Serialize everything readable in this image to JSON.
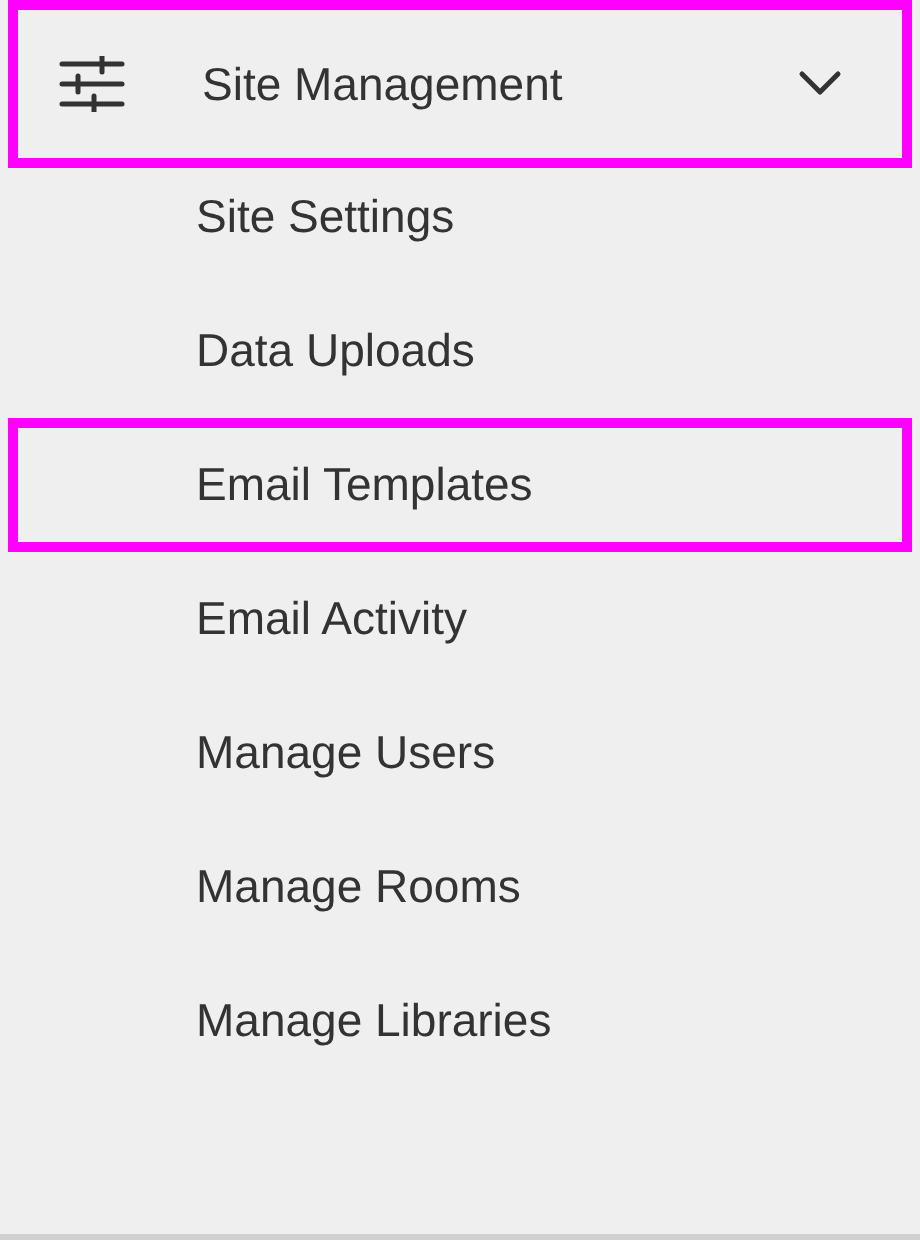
{
  "section": {
    "title": "Site Management",
    "expanded": true,
    "highlighted": true
  },
  "items": [
    {
      "label": "Site Settings",
      "highlighted": false
    },
    {
      "label": "Data Uploads",
      "highlighted": false
    },
    {
      "label": "Email Templates",
      "highlighted": true
    },
    {
      "label": "Email Activity",
      "highlighted": false
    },
    {
      "label": "Manage Users",
      "highlighted": false
    },
    {
      "label": "Manage Rooms",
      "highlighted": false
    },
    {
      "label": "Manage Libraries",
      "highlighted": false
    }
  ]
}
